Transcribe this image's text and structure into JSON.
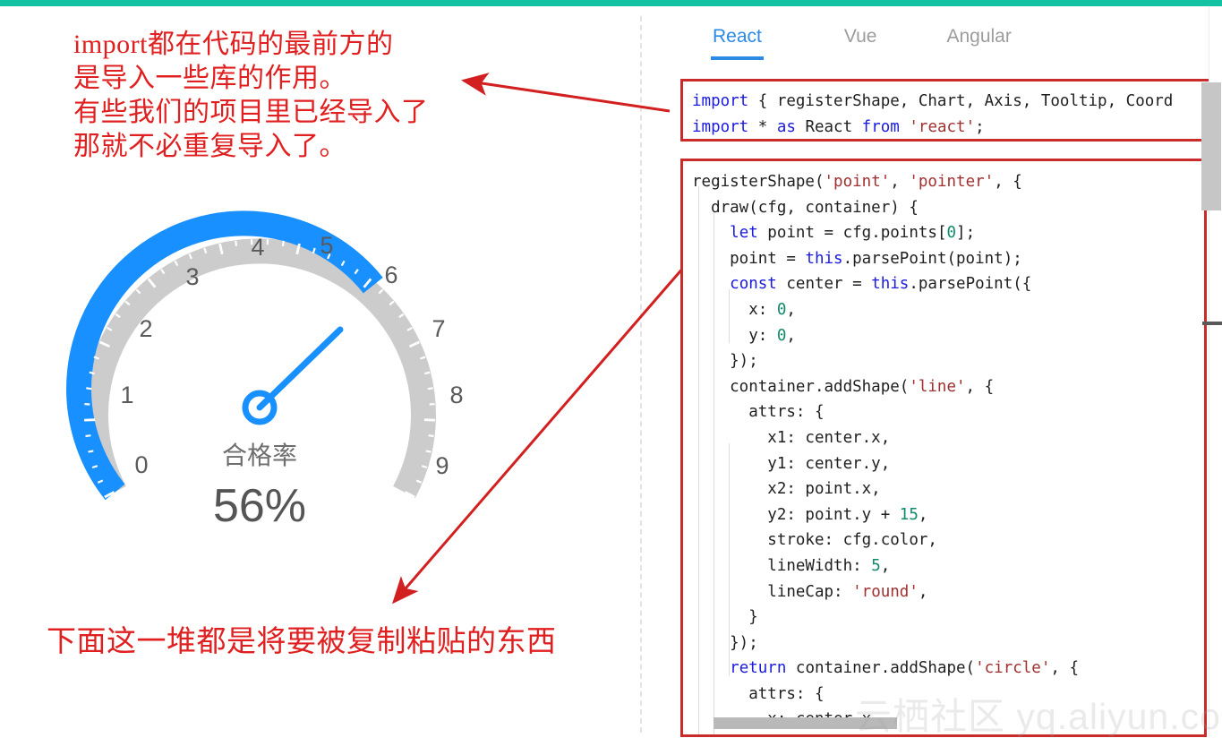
{
  "theme": {
    "top_bar_color": "#13c2a3",
    "accent_blue": "#2b8ae5",
    "annotation_red": "#e02020",
    "code_border_red": "#c92a2a",
    "gauge_active_color": "#1890ff",
    "gauge_inactive_color": "#cccccc"
  },
  "annotations": {
    "top_note": "import都在代码的最前方的\n是导入一些库的作用。\n有些我们的项目里已经导入了\n那就不必重复导入了。",
    "bottom_note": "下面这一堆都是将要被复制粘贴的东西"
  },
  "gauge": {
    "title": "合格率",
    "value_label": "56%",
    "value_percent": 56,
    "tick_labels": [
      "0",
      "1",
      "2",
      "3",
      "4",
      "5",
      "6",
      "7",
      "8",
      "9"
    ],
    "min": 0,
    "max": 9
  },
  "tabs": {
    "items": [
      {
        "label": "React",
        "active": true
      },
      {
        "label": "Vue",
        "active": false
      },
      {
        "label": "Angular",
        "active": false
      }
    ]
  },
  "code_import": {
    "lines": [
      [
        {
          "t": "import",
          "c": "kw"
        },
        {
          "t": " { registerShape, Chart, Axis, Tooltip, Coord",
          "c": ""
        }
      ],
      [
        {
          "t": "import",
          "c": "kw"
        },
        {
          "t": " * ",
          "c": ""
        },
        {
          "t": "as",
          "c": "kw"
        },
        {
          "t": " React ",
          "c": ""
        },
        {
          "t": "from",
          "c": "kw"
        },
        {
          "t": " ",
          "c": ""
        },
        {
          "t": "'react'",
          "c": "str"
        },
        {
          "t": ";",
          "c": ""
        }
      ]
    ]
  },
  "code_main": {
    "lines": [
      [
        {
          "t": "registerShape(",
          "c": ""
        },
        {
          "t": "'point'",
          "c": "str"
        },
        {
          "t": ", ",
          "c": ""
        },
        {
          "t": "'pointer'",
          "c": "str"
        },
        {
          "t": ", {",
          "c": ""
        }
      ],
      [
        {
          "t": "  draw(cfg, container) {",
          "c": ""
        }
      ],
      [
        {
          "t": "    ",
          "c": ""
        },
        {
          "t": "let",
          "c": "kw"
        },
        {
          "t": " point = cfg.points[",
          "c": ""
        },
        {
          "t": "0",
          "c": "num"
        },
        {
          "t": "];",
          "c": ""
        }
      ],
      [
        {
          "t": "    point = ",
          "c": ""
        },
        {
          "t": "this",
          "c": "kw"
        },
        {
          "t": ".parsePoint(point);",
          "c": ""
        }
      ],
      [
        {
          "t": "    ",
          "c": ""
        },
        {
          "t": "const",
          "c": "kw"
        },
        {
          "t": " center = ",
          "c": ""
        },
        {
          "t": "this",
          "c": "kw"
        },
        {
          "t": ".parsePoint({",
          "c": ""
        }
      ],
      [
        {
          "t": "      x: ",
          "c": ""
        },
        {
          "t": "0",
          "c": "num"
        },
        {
          "t": ",",
          "c": ""
        }
      ],
      [
        {
          "t": "      y: ",
          "c": ""
        },
        {
          "t": "0",
          "c": "num"
        },
        {
          "t": ",",
          "c": ""
        }
      ],
      [
        {
          "t": "    });",
          "c": ""
        }
      ],
      [
        {
          "t": "    container.addShape(",
          "c": ""
        },
        {
          "t": "'line'",
          "c": "str"
        },
        {
          "t": ", {",
          "c": ""
        }
      ],
      [
        {
          "t": "      attrs: {",
          "c": ""
        }
      ],
      [
        {
          "t": "        x1: center.x,",
          "c": ""
        }
      ],
      [
        {
          "t": "        y1: center.y,",
          "c": ""
        }
      ],
      [
        {
          "t": "        x2: point.x,",
          "c": ""
        }
      ],
      [
        {
          "t": "        y2: point.y + ",
          "c": ""
        },
        {
          "t": "15",
          "c": "num"
        },
        {
          "t": ",",
          "c": ""
        }
      ],
      [
        {
          "t": "        stroke: cfg.color,",
          "c": ""
        }
      ],
      [
        {
          "t": "        lineWidth: ",
          "c": ""
        },
        {
          "t": "5",
          "c": "num"
        },
        {
          "t": ",",
          "c": ""
        }
      ],
      [
        {
          "t": "        lineCap: ",
          "c": ""
        },
        {
          "t": "'round'",
          "c": "str"
        },
        {
          "t": ",",
          "c": ""
        }
      ],
      [
        {
          "t": "      }",
          "c": ""
        }
      ],
      [
        {
          "t": "    });",
          "c": ""
        }
      ],
      [
        {
          "t": "    ",
          "c": ""
        },
        {
          "t": "return",
          "c": "kw"
        },
        {
          "t": " container.addShape(",
          "c": ""
        },
        {
          "t": "'circle'",
          "c": "str"
        },
        {
          "t": ", {",
          "c": ""
        }
      ],
      [
        {
          "t": "      attrs: {",
          "c": ""
        }
      ],
      [
        {
          "t": "        x: center.x,",
          "c": ""
        }
      ]
    ]
  },
  "watermark": {
    "text": "云栖社区 yq.aliyun.com"
  }
}
